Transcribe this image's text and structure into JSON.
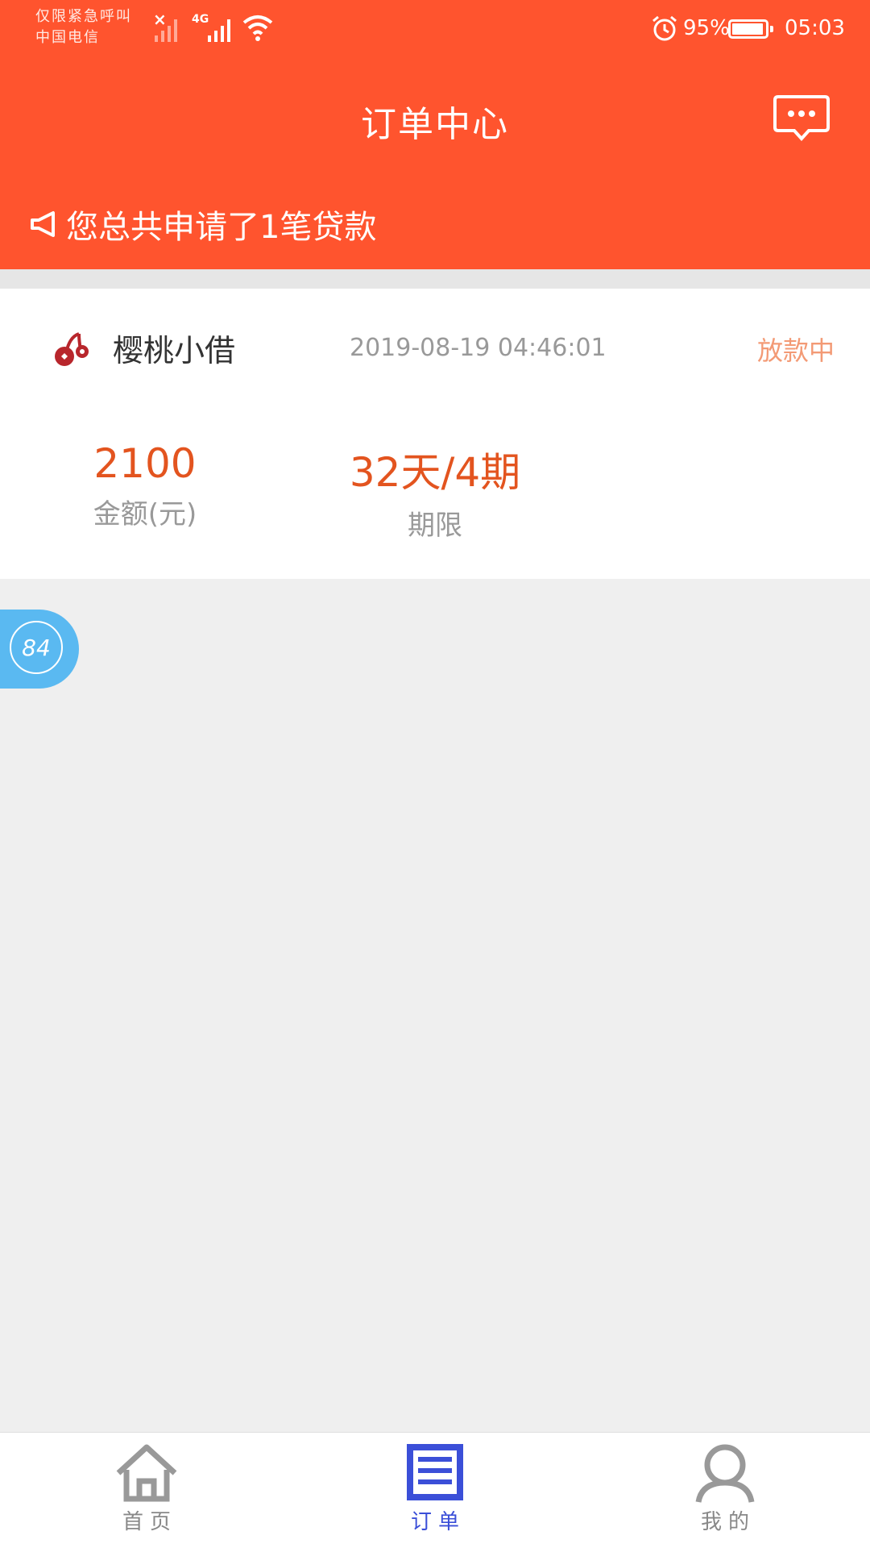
{
  "status_bar": {
    "carrier_line1": "仅限紧急呼叫",
    "carrier_line2": "中国电信",
    "network_type": "4G",
    "battery_percent": "95%",
    "time": "05:03"
  },
  "header": {
    "title": "订单中心",
    "message_icon": "chat-bubble-icon",
    "notice_icon": "megaphone-icon",
    "notice_text": "您总共申请了1笔贷款"
  },
  "order": {
    "brand_icon": "cherry-logo-icon",
    "brand_name": "樱桃小借",
    "time": "2019-08-19 04:46:01",
    "status": "放款中",
    "amount_value": "2100",
    "amount_label": "金额(元)",
    "term_value": "32天/4期",
    "term_label": "期限"
  },
  "floating_badge": {
    "text": "84"
  },
  "tabbar": {
    "tabs": [
      {
        "label": "首页",
        "icon": "home-icon",
        "active": false
      },
      {
        "label": "订单",
        "icon": "orders-icon",
        "active": true
      },
      {
        "label": "我的",
        "icon": "user-icon",
        "active": false
      }
    ]
  },
  "colors": {
    "header_bg": "#ff542e",
    "accent_value": "#e3541f",
    "status_text": "#f39a75",
    "active_tab": "#3b4fd8",
    "badge_bg": "#5ab9f1",
    "page_bg": "#efefef"
  }
}
